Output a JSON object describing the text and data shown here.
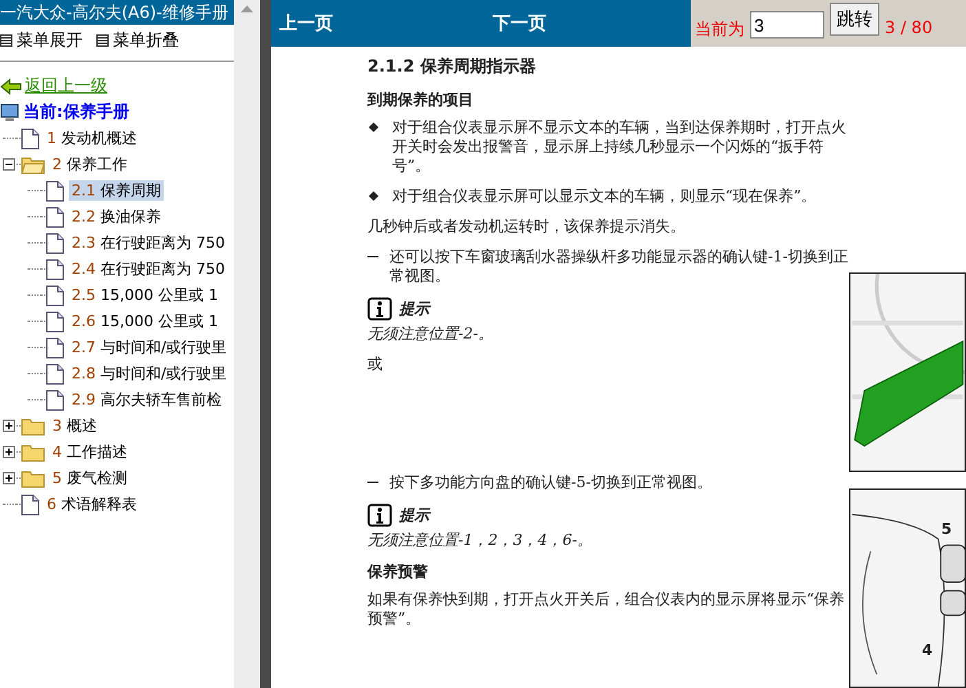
{
  "sidebar": {
    "title": "一汽大众-高尔夫(A6)-维修手册",
    "menu": [
      {
        "label": "菜单展开"
      },
      {
        "label": "菜单折叠"
      }
    ],
    "back_link": "返回上一级",
    "current": "当前:保养手册",
    "tree": [
      {
        "number": "1",
        "label": "发动机概述",
        "kind": "page",
        "selected": false
      },
      {
        "number": "2",
        "label": "保养工作",
        "kind": "folder",
        "expanded": true,
        "selected": false,
        "children": [
          {
            "number": "2.1",
            "label": "保养周期",
            "kind": "page",
            "selected": true
          },
          {
            "number": "2.2",
            "label": "换油保养",
            "kind": "page",
            "selected": false
          },
          {
            "number": "2.3",
            "label": "在行驶距离为 750",
            "kind": "page",
            "selected": false
          },
          {
            "number": "2.4",
            "label": "在行驶距离为 750",
            "kind": "page",
            "selected": false
          },
          {
            "number": "2.5",
            "label": "15,000 公里或 1",
            "kind": "page",
            "selected": false
          },
          {
            "number": "2.6",
            "label": "15,000 公里或 1",
            "kind": "page",
            "selected": false
          },
          {
            "number": "2.7",
            "label": "与时间和/或行驶里",
            "kind": "page",
            "selected": false
          },
          {
            "number": "2.8",
            "label": "与时间和/或行驶里",
            "kind": "page",
            "selected": false
          },
          {
            "number": "2.9",
            "label": "高尔夫轿车售前检",
            "kind": "page",
            "selected": false
          }
        ]
      },
      {
        "number": "3",
        "label": "概述",
        "kind": "folder",
        "expanded": false,
        "selected": false
      },
      {
        "number": "4",
        "label": "工作描述",
        "kind": "folder",
        "expanded": false,
        "selected": false
      },
      {
        "number": "5",
        "label": "废气检测",
        "kind": "folder",
        "expanded": false,
        "selected": false
      },
      {
        "number": "6",
        "label": "术语解释表",
        "kind": "page",
        "selected": false
      }
    ]
  },
  "toolbar": {
    "prev": "上一页",
    "next": "下一页",
    "current_label": "当前为",
    "page_input": "3",
    "go_button": "跳转",
    "page_count": "3 / 80"
  },
  "document": {
    "heading": "2.1.2 保养周期指示器",
    "blocks": [
      {
        "kind": "subheading",
        "text": "到期保养的项目"
      },
      {
        "kind": "bullet",
        "text": "对于组合仪表显示屏不显示文本的车辆，当到达保养期时，打开点火开关时会发出报警音，显示屏上持续几秒显示一个闪烁的“扳手符号”。"
      },
      {
        "kind": "bullet",
        "text": "对于组合仪表显示屏可以显示文本的车辆，则显示“现在保养”。"
      },
      {
        "kind": "para",
        "text": "几秒钟后或者发动机运转时，该保养提示消失。"
      },
      {
        "kind": "dash",
        "text": "还可以按下车窗玻璃刮水器操纵杆多功能显示器的确认键-1-切换到正常视图。"
      },
      {
        "kind": "note",
        "title": "提示",
        "text": "无须注意位置-2-。"
      },
      {
        "kind": "para",
        "text": "或"
      },
      {
        "kind": "gap"
      },
      {
        "kind": "dash",
        "text": "按下多功能方向盘的确认键-5-切换到正常视图。"
      },
      {
        "kind": "note",
        "title": "提示",
        "text": "无须注意位置-1，2，3，4，6-。"
      },
      {
        "kind": "subheading",
        "text": "保养预警"
      },
      {
        "kind": "para",
        "text": "如果有保养快到期，打开点火开关后，组合仪表内的显示屏将显示“保养预警”。"
      }
    ],
    "figures": [
      {
        "kind": "lever"
      },
      {
        "kind": "wheel",
        "labels": [
          "5",
          "4"
        ]
      }
    ]
  }
}
